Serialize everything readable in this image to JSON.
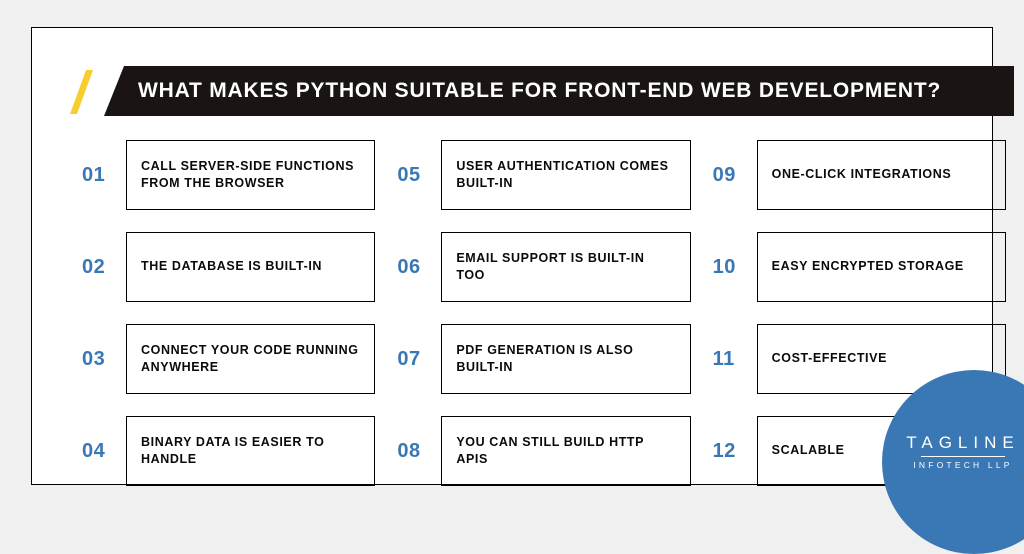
{
  "title": "WHAT MAKES PYTHON SUITABLE FOR FRONT-END WEB DEVELOPMENT?",
  "items": [
    {
      "num": "01",
      "text": "CALL SERVER-SIDE FUNCTIONS FROM THE BROWSER"
    },
    {
      "num": "02",
      "text": "THE DATABASE IS BUILT-IN"
    },
    {
      "num": "03",
      "text": "CONNECT YOUR CODE RUNNING ANYWHERE"
    },
    {
      "num": "04",
      "text": "BINARY DATA IS EASIER TO HANDLE"
    },
    {
      "num": "05",
      "text": "USER AUTHENTICATION COMES BUILT-IN"
    },
    {
      "num": "06",
      "text": "EMAIL SUPPORT IS BUILT-IN TOO"
    },
    {
      "num": "07",
      "text": "PDF GENERATION IS ALSO BUILT-IN"
    },
    {
      "num": "08",
      "text": "YOU CAN STILL BUILD HTTP APIS"
    },
    {
      "num": "09",
      "text": "ONE-CLICK INTEGRATIONS"
    },
    {
      "num": "10",
      "text": "EASY ENCRYPTED STORAGE"
    },
    {
      "num": "11",
      "text": "COST-EFFECTIVE"
    },
    {
      "num": "12",
      "text": "SCALABLE"
    }
  ],
  "brand": {
    "top": "TAGLINE",
    "bottom": "INFOTECH LLP"
  },
  "colors": {
    "accent_yellow": "#f8ce2e",
    "dark_header": "#1a1412",
    "brand_blue": "#3a78b5"
  }
}
